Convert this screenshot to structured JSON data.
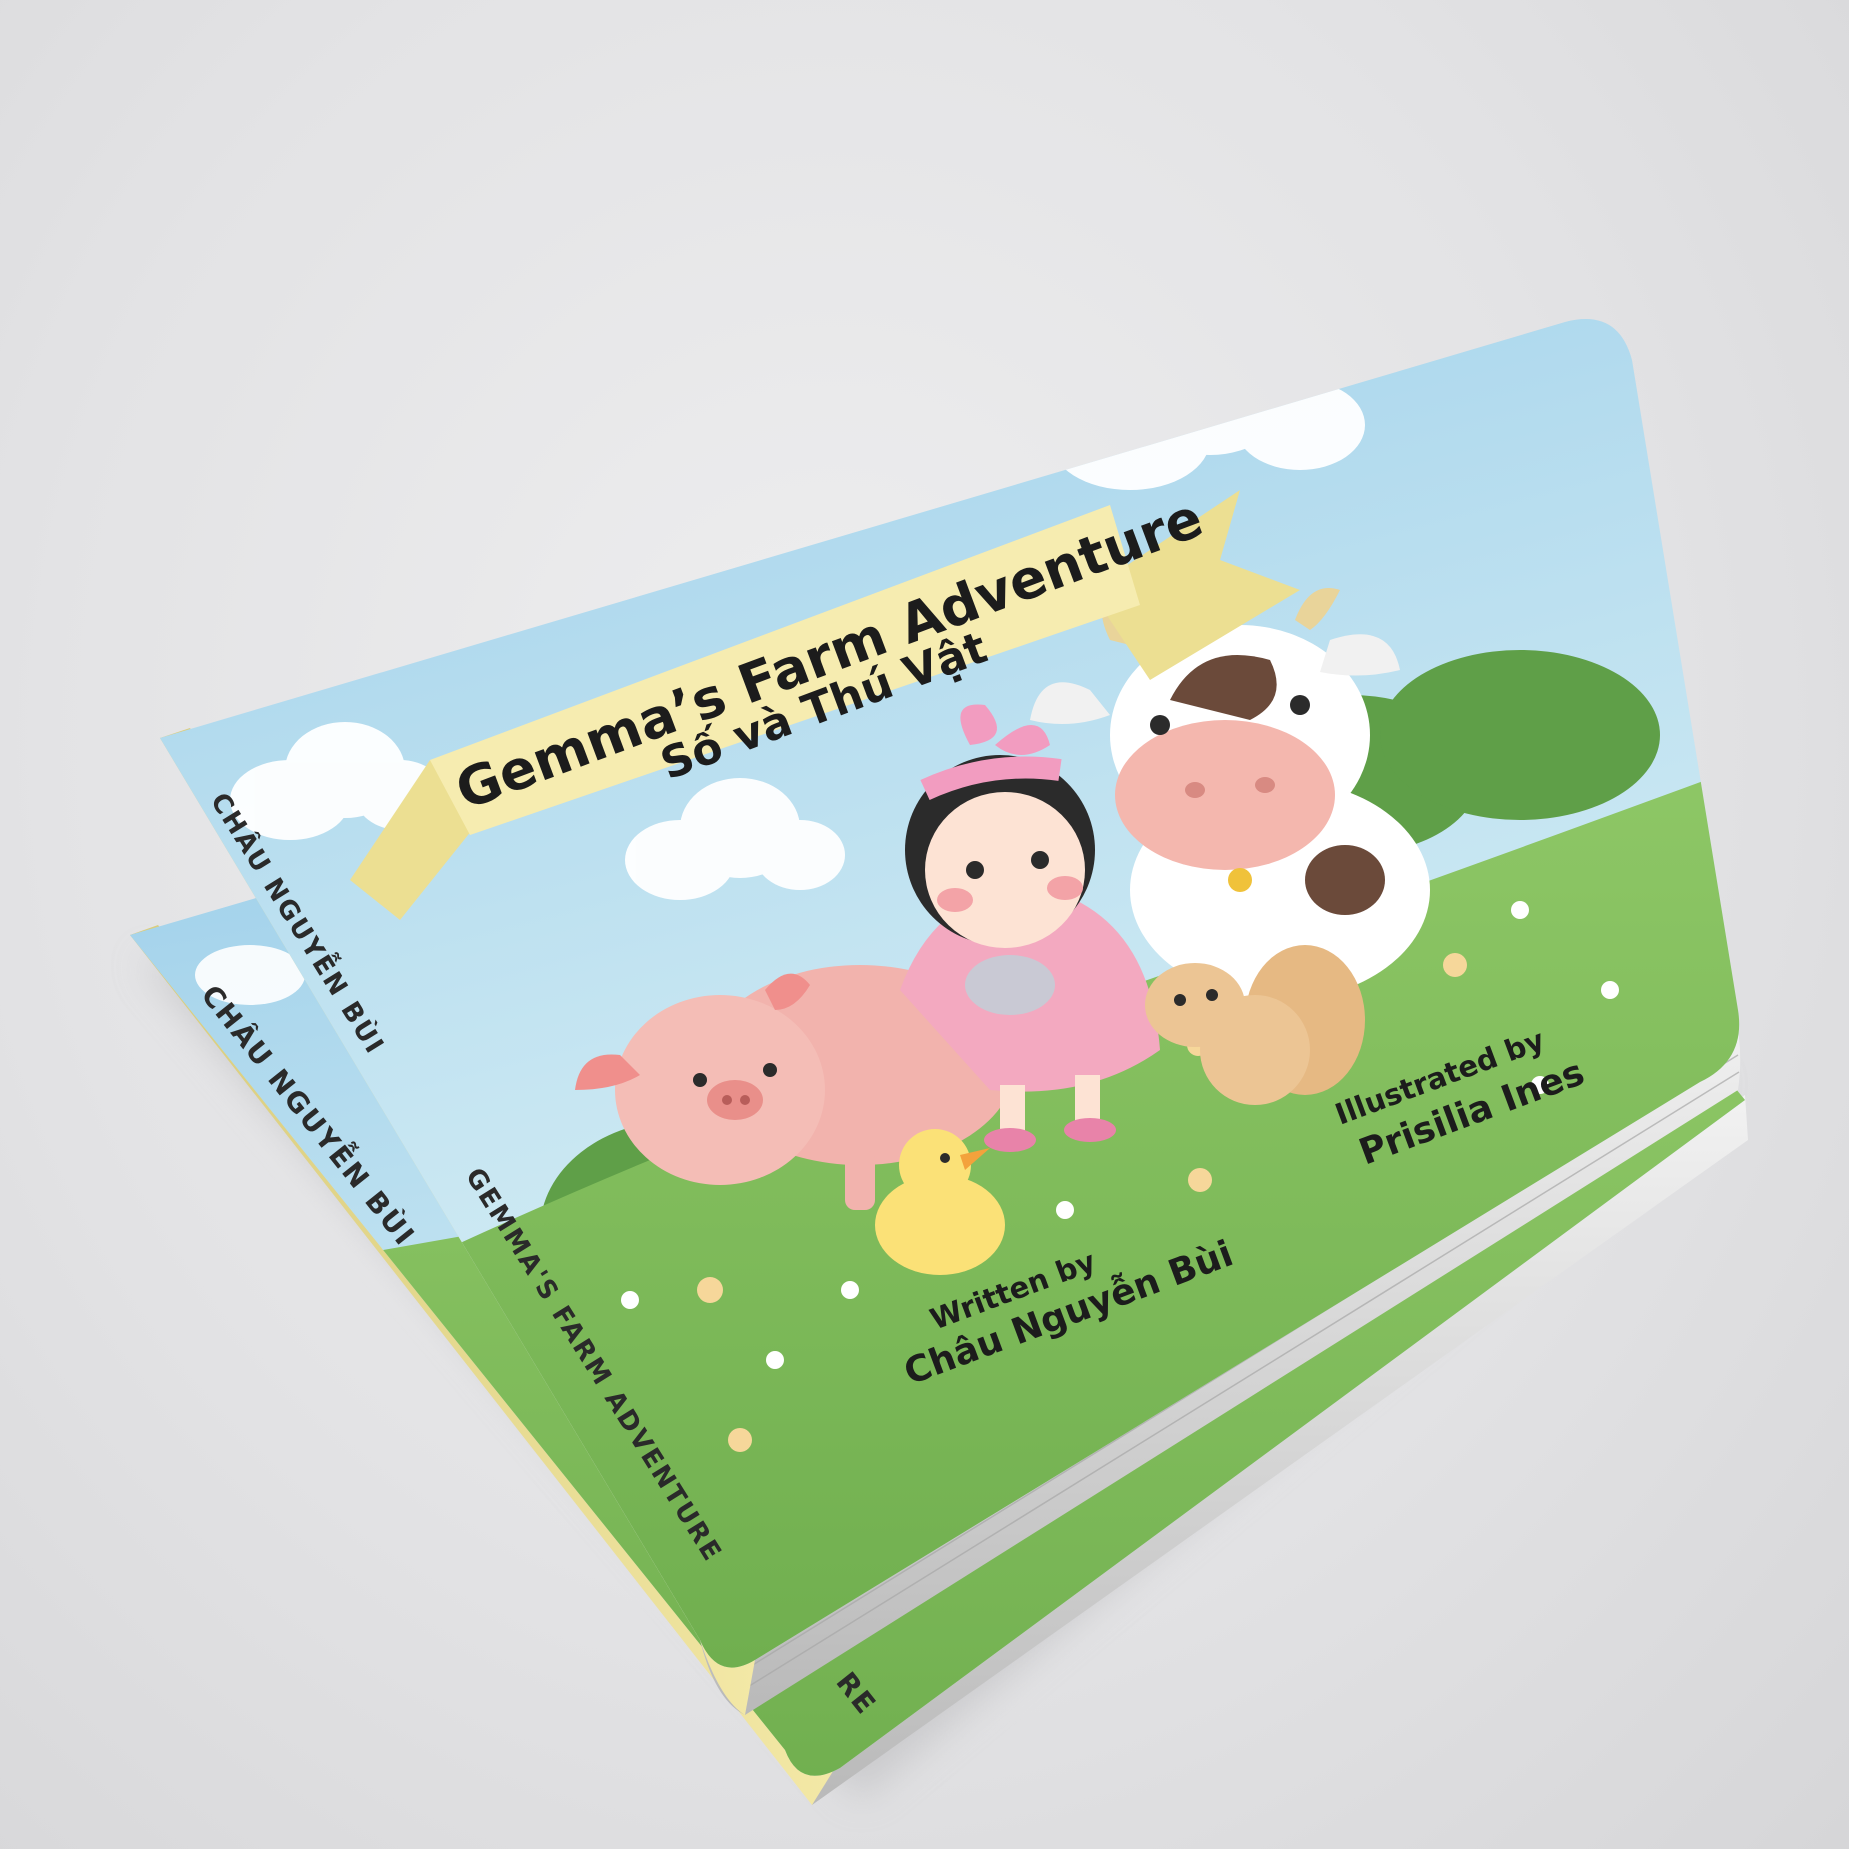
{
  "book": {
    "title": "Gemma’s Farm Adventure",
    "subtitle": "Số và Thú Vật",
    "written_by_label": "Written by",
    "author": "Châu Nguyễn Bùi",
    "illustrated_by_label": "Illustrated by",
    "illustrator": "Prisilia Ines"
  },
  "spine": {
    "top_author": "CHÂU NGUYỄN BÙI",
    "top_title": "GEMMA'S FARM ADVENTURE",
    "bottom_author": "CHÂU NGUYỄN BÙI",
    "bottom_title_fragment": "RE"
  },
  "colors": {
    "sky": "#a9d6ec",
    "grass": "#7cb55a",
    "ribbon": "#f6ecb0",
    "spine": "#efe39a",
    "background": "#e2e2e4"
  }
}
